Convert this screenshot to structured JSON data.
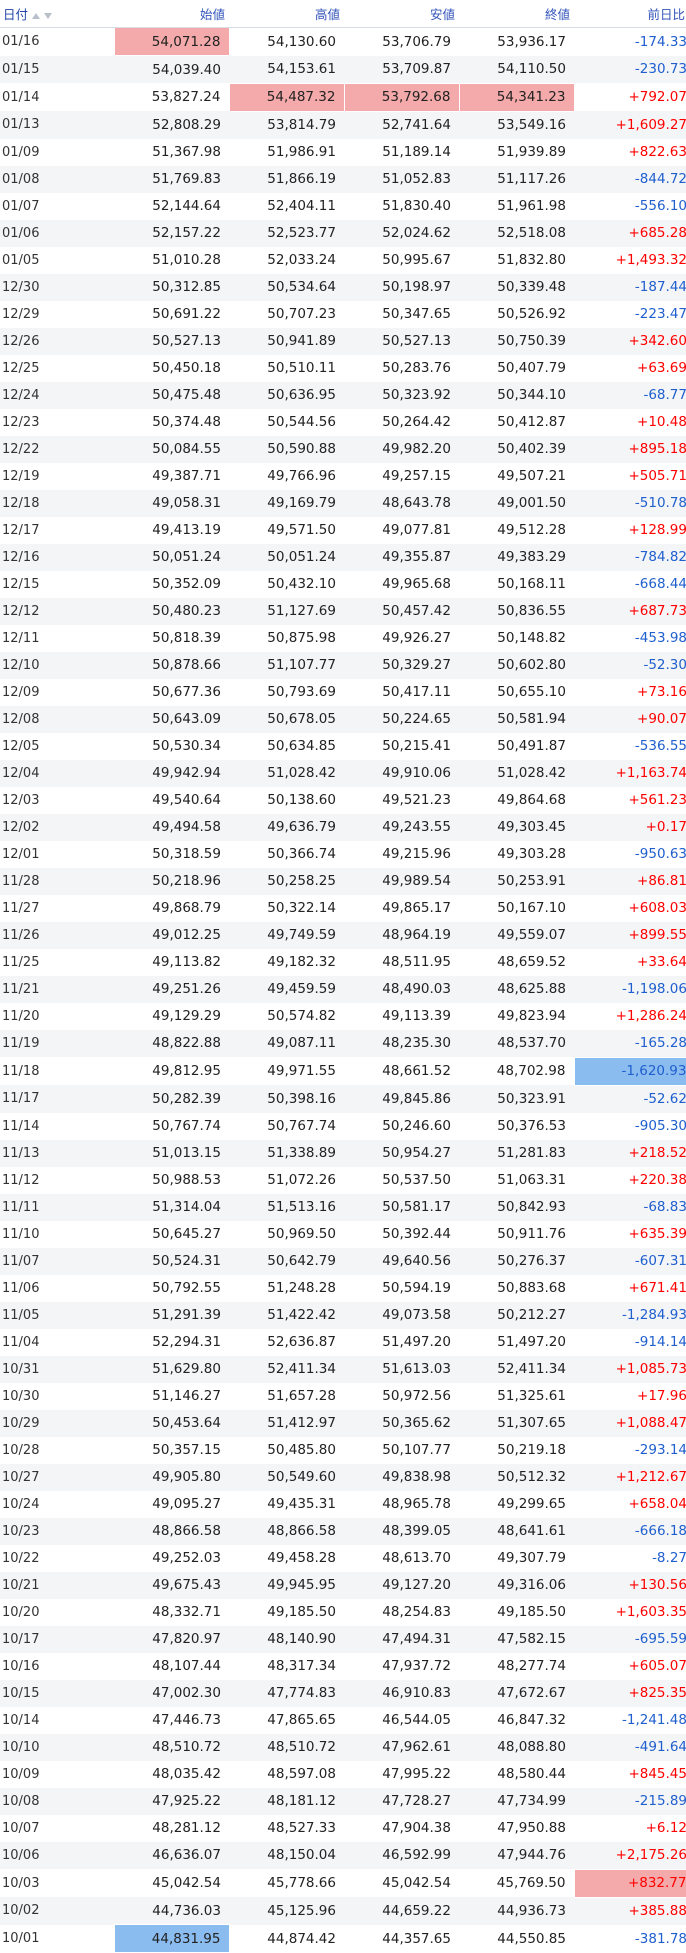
{
  "header": {
    "date": "日付",
    "open": "始値",
    "high": "高値",
    "low": "安値",
    "close": "終値",
    "change": "前日比",
    "sort_icons": [
      "sort-up-icon",
      "sort-down-icon"
    ]
  },
  "colors": {
    "up": "#ff0000",
    "down": "#1f5fce",
    "highlight_red": "#f4aaaa",
    "highlight_blue": "#8bbcf0"
  },
  "rows": [
    [
      "01/16",
      "54,071.28",
      "54,130.60",
      "53,706.79",
      "53,936.17",
      "-174.33"
    ],
    [
      "01/15",
      "54,039.40",
      "54,153.61",
      "53,709.87",
      "54,110.50",
      "-230.73"
    ],
    [
      "01/14",
      "53,827.24",
      "54,487.32",
      "53,792.68",
      "54,341.23",
      "+792.07"
    ],
    [
      "01/13",
      "52,808.29",
      "53,814.79",
      "52,741.64",
      "53,549.16",
      "+1,609.27"
    ],
    [
      "01/09",
      "51,367.98",
      "51,986.91",
      "51,189.14",
      "51,939.89",
      "+822.63"
    ],
    [
      "01/08",
      "51,769.83",
      "51,866.19",
      "51,052.83",
      "51,117.26",
      "-844.72"
    ],
    [
      "01/07",
      "52,144.64",
      "52,404.11",
      "51,830.40",
      "51,961.98",
      "-556.10"
    ],
    [
      "01/06",
      "52,157.22",
      "52,523.77",
      "52,024.62",
      "52,518.08",
      "+685.28"
    ],
    [
      "01/05",
      "51,010.28",
      "52,033.24",
      "50,995.67",
      "51,832.80",
      "+1,493.32"
    ],
    [
      "12/30",
      "50,312.85",
      "50,534.64",
      "50,198.97",
      "50,339.48",
      "-187.44"
    ],
    [
      "12/29",
      "50,691.22",
      "50,707.23",
      "50,347.65",
      "50,526.92",
      "-223.47"
    ],
    [
      "12/26",
      "50,527.13",
      "50,941.89",
      "50,527.13",
      "50,750.39",
      "+342.60"
    ],
    [
      "12/25",
      "50,450.18",
      "50,510.11",
      "50,283.76",
      "50,407.79",
      "+63.69"
    ],
    [
      "12/24",
      "50,475.48",
      "50,636.95",
      "50,323.92",
      "50,344.10",
      "-68.77"
    ],
    [
      "12/23",
      "50,374.48",
      "50,544.56",
      "50,264.42",
      "50,412.87",
      "+10.48"
    ],
    [
      "12/22",
      "50,084.55",
      "50,590.88",
      "49,982.20",
      "50,402.39",
      "+895.18"
    ],
    [
      "12/19",
      "49,387.71",
      "49,766.96",
      "49,257.15",
      "49,507.21",
      "+505.71"
    ],
    [
      "12/18",
      "49,058.31",
      "49,169.79",
      "48,643.78",
      "49,001.50",
      "-510.78"
    ],
    [
      "12/17",
      "49,413.19",
      "49,571.50",
      "49,077.81",
      "49,512.28",
      "+128.99"
    ],
    [
      "12/16",
      "50,051.24",
      "50,051.24",
      "49,355.87",
      "49,383.29",
      "-784.82"
    ],
    [
      "12/15",
      "50,352.09",
      "50,432.10",
      "49,965.68",
      "50,168.11",
      "-668.44"
    ],
    [
      "12/12",
      "50,480.23",
      "51,127.69",
      "50,457.42",
      "50,836.55",
      "+687.73"
    ],
    [
      "12/11",
      "50,818.39",
      "50,875.98",
      "49,926.27",
      "50,148.82",
      "-453.98"
    ],
    [
      "12/10",
      "50,878.66",
      "51,107.77",
      "50,329.27",
      "50,602.80",
      "-52.30"
    ],
    [
      "12/09",
      "50,677.36",
      "50,793.69",
      "50,417.11",
      "50,655.10",
      "+73.16"
    ],
    [
      "12/08",
      "50,643.09",
      "50,678.05",
      "50,224.65",
      "50,581.94",
      "+90.07"
    ],
    [
      "12/05",
      "50,530.34",
      "50,634.85",
      "50,215.41",
      "50,491.87",
      "-536.55"
    ],
    [
      "12/04",
      "49,942.94",
      "51,028.42",
      "49,910.06",
      "51,028.42",
      "+1,163.74"
    ],
    [
      "12/03",
      "49,540.64",
      "50,138.60",
      "49,521.23",
      "49,864.68",
      "+561.23"
    ],
    [
      "12/02",
      "49,494.58",
      "49,636.79",
      "49,243.55",
      "49,303.45",
      "+0.17"
    ],
    [
      "12/01",
      "50,318.59",
      "50,366.74",
      "49,215.96",
      "49,303.28",
      "-950.63"
    ],
    [
      "11/28",
      "50,218.96",
      "50,258.25",
      "49,989.54",
      "50,253.91",
      "+86.81"
    ],
    [
      "11/27",
      "49,868.79",
      "50,322.14",
      "49,865.17",
      "50,167.10",
      "+608.03"
    ],
    [
      "11/26",
      "49,012.25",
      "49,749.59",
      "48,964.19",
      "49,559.07",
      "+899.55"
    ],
    [
      "11/25",
      "49,113.82",
      "49,182.32",
      "48,511.95",
      "48,659.52",
      "+33.64"
    ],
    [
      "11/21",
      "49,251.26",
      "49,459.59",
      "48,490.03",
      "48,625.88",
      "-1,198.06"
    ],
    [
      "11/20",
      "49,129.29",
      "50,574.82",
      "49,113.39",
      "49,823.94",
      "+1,286.24"
    ],
    [
      "11/19",
      "48,822.88",
      "49,087.11",
      "48,235.30",
      "48,537.70",
      "-165.28"
    ],
    [
      "11/18",
      "49,812.95",
      "49,971.55",
      "48,661.52",
      "48,702.98",
      "-1,620.93"
    ],
    [
      "11/17",
      "50,282.39",
      "50,398.16",
      "49,845.86",
      "50,323.91",
      "-52.62"
    ],
    [
      "11/14",
      "50,767.74",
      "50,767.74",
      "50,246.60",
      "50,376.53",
      "-905.30"
    ],
    [
      "11/13",
      "51,013.15",
      "51,338.89",
      "50,954.27",
      "51,281.83",
      "+218.52"
    ],
    [
      "11/12",
      "50,988.53",
      "51,072.26",
      "50,537.50",
      "51,063.31",
      "+220.38"
    ],
    [
      "11/11",
      "51,314.04",
      "51,513.16",
      "50,581.17",
      "50,842.93",
      "-68.83"
    ],
    [
      "11/10",
      "50,645.27",
      "50,969.50",
      "50,392.44",
      "50,911.76",
      "+635.39"
    ],
    [
      "11/07",
      "50,524.31",
      "50,642.79",
      "49,640.56",
      "50,276.37",
      "-607.31"
    ],
    [
      "11/06",
      "50,792.55",
      "51,248.28",
      "50,594.19",
      "50,883.68",
      "+671.41"
    ],
    [
      "11/05",
      "51,291.39",
      "51,422.42",
      "49,073.58",
      "50,212.27",
      "-1,284.93"
    ],
    [
      "11/04",
      "52,294.31",
      "52,636.87",
      "51,497.20",
      "51,497.20",
      "-914.14"
    ],
    [
      "10/31",
      "51,629.80",
      "52,411.34",
      "51,613.03",
      "52,411.34",
      "+1,085.73"
    ],
    [
      "10/30",
      "51,146.27",
      "51,657.28",
      "50,972.56",
      "51,325.61",
      "+17.96"
    ],
    [
      "10/29",
      "50,453.64",
      "51,412.97",
      "50,365.62",
      "51,307.65",
      "+1,088.47"
    ],
    [
      "10/28",
      "50,357.15",
      "50,485.80",
      "50,107.77",
      "50,219.18",
      "-293.14"
    ],
    [
      "10/27",
      "49,905.80",
      "50,549.60",
      "49,838.98",
      "50,512.32",
      "+1,212.67"
    ],
    [
      "10/24",
      "49,095.27",
      "49,435.31",
      "48,965.78",
      "49,299.65",
      "+658.04"
    ],
    [
      "10/23",
      "48,866.58",
      "48,866.58",
      "48,399.05",
      "48,641.61",
      "-666.18"
    ],
    [
      "10/22",
      "49,252.03",
      "49,458.28",
      "48,613.70",
      "49,307.79",
      "-8.27"
    ],
    [
      "10/21",
      "49,675.43",
      "49,945.95",
      "49,127.20",
      "49,316.06",
      "+130.56"
    ],
    [
      "10/20",
      "48,332.71",
      "49,185.50",
      "48,254.83",
      "49,185.50",
      "+1,603.35"
    ],
    [
      "10/17",
      "47,820.97",
      "48,140.90",
      "47,494.31",
      "47,582.15",
      "-695.59"
    ],
    [
      "10/16",
      "48,107.44",
      "48,317.34",
      "47,937.72",
      "48,277.74",
      "+605.07"
    ],
    [
      "10/15",
      "47,002.30",
      "47,774.83",
      "46,910.83",
      "47,672.67",
      "+825.35"
    ],
    [
      "10/14",
      "47,446.73",
      "47,865.65",
      "46,544.05",
      "46,847.32",
      "-1,241.48"
    ],
    [
      "10/10",
      "48,510.72",
      "48,510.72",
      "47,962.61",
      "48,088.80",
      "-491.64"
    ],
    [
      "10/09",
      "48,035.42",
      "48,597.08",
      "47,995.22",
      "48,580.44",
      "+845.45"
    ],
    [
      "10/08",
      "47,925.22",
      "48,181.12",
      "47,728.27",
      "47,734.99",
      "-215.89"
    ],
    [
      "10/07",
      "48,281.12",
      "48,527.33",
      "47,904.38",
      "47,950.88",
      "+6.12"
    ],
    [
      "10/06",
      "46,636.07",
      "48,150.04",
      "46,592.99",
      "47,944.76",
      "+2,175.26"
    ],
    [
      "10/03",
      "45,042.54",
      "45,778.66",
      "45,042.54",
      "45,769.50",
      "+832.77"
    ],
    [
      "10/02",
      "44,736.03",
      "45,125.96",
      "44,659.22",
      "44,936.73",
      "+385.88"
    ],
    [
      "10/01",
      "44,831.95",
      "44,874.42",
      "44,357.65",
      "44,550.85",
      "-381.78"
    ]
  ],
  "highlights": {
    "red": [
      [
        0,
        1
      ],
      [
        2,
        2
      ],
      [
        2,
        3
      ],
      [
        2,
        4
      ],
      [
        68,
        5
      ]
    ],
    "blue": [
      [
        70,
        1
      ],
      [
        71,
        2
      ],
      [
        71,
        3
      ],
      [
        71,
        4
      ],
      [
        38,
        5
      ]
    ]
  }
}
